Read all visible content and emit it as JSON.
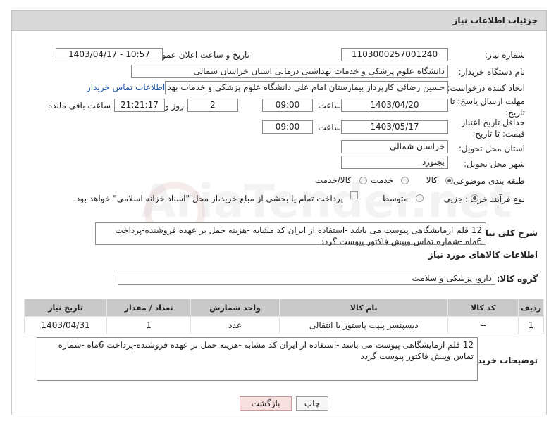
{
  "header": {
    "title": "جزئیات اطلاعات نیاز"
  },
  "form": {
    "need_number_label": "شماره نیاز:",
    "need_number": "1103000257001240",
    "announce_label": "تاریخ و ساعت اعلان عمومی:",
    "announce_value": "1403/04/17 - 10:57",
    "buyer_org_label": "نام دستگاه خریدار:",
    "buyer_org": "دانشگاه علوم پزشکی و خدمات بهداشتی درمانی استان خراسان شمالی",
    "creator_label": "ایجاد کننده درخواست:",
    "creator": "حسین رضائی کارپرداز بیمارستان امام علی دانشگاه علوم پزشکی و خدمات بهد",
    "contact_link": "اطلاعات تماس خریدار",
    "reply_deadline_label": "مهلت ارسال پاسخ: تا تاریخ:",
    "reply_date": "1403/04/20",
    "time_label": "ساعت",
    "reply_time": "09:00",
    "days_value": "2",
    "days_label": "روز و",
    "remaining_time": "21:21:17",
    "remaining_label": "ساعت باقی مانده",
    "validity_label": "حداقل تاریخ اعتبار قیمت: تا تاریخ:",
    "validity_date": "1403/05/17",
    "validity_time": "09:00",
    "province_label": "استان محل تحویل:",
    "province": "خراسان شمالی",
    "city_label": "شهر محل تحویل:",
    "city": "بجنورد",
    "category_label": "طبقه بندی موضوعی:",
    "category_options": [
      "کالا",
      "خدمت",
      "کالا/خدمت"
    ],
    "process_label": "نوع فرآیند خرید :",
    "process_options": [
      "جزیی",
      "متوسط"
    ],
    "payment_note": "پرداخت تمام یا بخشی از مبلغ خرید،از محل \"اسناد خزانه اسلامی\" خواهد بود.",
    "description_label": "شرح کلی نیاز:",
    "description": "12 قلم ازمایشگاهی پیوست می باشد -استفاده از ایران کد مشابه -هزینه حمل بر عهده فروشنده-پرداخت 6ماه -شماره تماس وپیش فاکتور پیوست گردد"
  },
  "goods": {
    "section_title": "اطلاعات کالاهای مورد نیاز",
    "group_label": "گروه کالا:",
    "group_value": "دارو، پزشکی و سلامت",
    "columns": [
      "ردیف",
      "کد کالا",
      "نام کالا",
      "واحد شمارش",
      "تعداد / مقدار",
      "تاریخ نیاز"
    ],
    "rows": [
      {
        "row": "1",
        "code": "--",
        "name": "دیسپنسر پیپت پاستور یا انتقالی",
        "unit": "عدد",
        "qty": "1",
        "date": "1403/04/31"
      }
    ]
  },
  "buyer_notes": {
    "label": "توضیحات خریدار:",
    "text": "12 قلم ازمایشگاهی پیوست می باشد -استفاده از ایران کد مشابه -هزینه حمل بر عهده فروشنده-پرداخت 6ماه -شماره تماس وپیش فاکتور پیوست گردد"
  },
  "buttons": {
    "print": "چاپ",
    "back": "بازگشت"
  },
  "watermark": "AriaTender.net",
  "colors": {
    "header_bg": "#d9d9d9",
    "table_header_bg": "#c9c9c9",
    "link": "#1a55a8",
    "back_button_bg": "#f8e0e0"
  }
}
